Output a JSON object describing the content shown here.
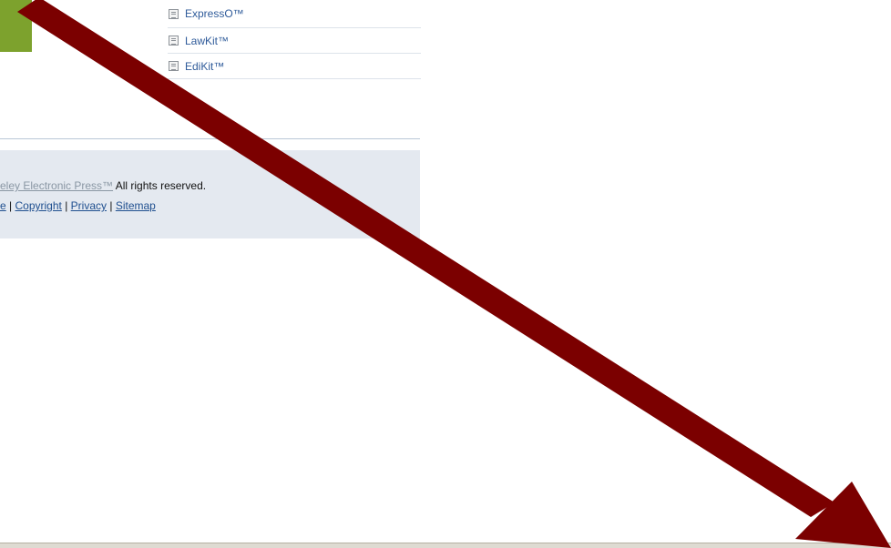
{
  "product_links": [
    {
      "label": "ExpressO™"
    },
    {
      "label": "LawKit™"
    },
    {
      "label": "EdiKit™"
    }
  ],
  "footer": {
    "press_label": "eley Electronic Press™",
    "rights_text": "All rights reserved.",
    "first_link_fragment": "e",
    "links": [
      {
        "label": "Copyright"
      },
      {
        "label": "Privacy"
      },
      {
        "label": "Sitemap"
      }
    ],
    "separator": "|"
  },
  "colors": {
    "accent_green": "#7da22d",
    "arrow": "#7b0000",
    "link": "#2f5b9a",
    "footer_background": "#e4e9f0"
  },
  "icons": {
    "product_item": "document-icon",
    "overlay": "arrow-icon"
  }
}
